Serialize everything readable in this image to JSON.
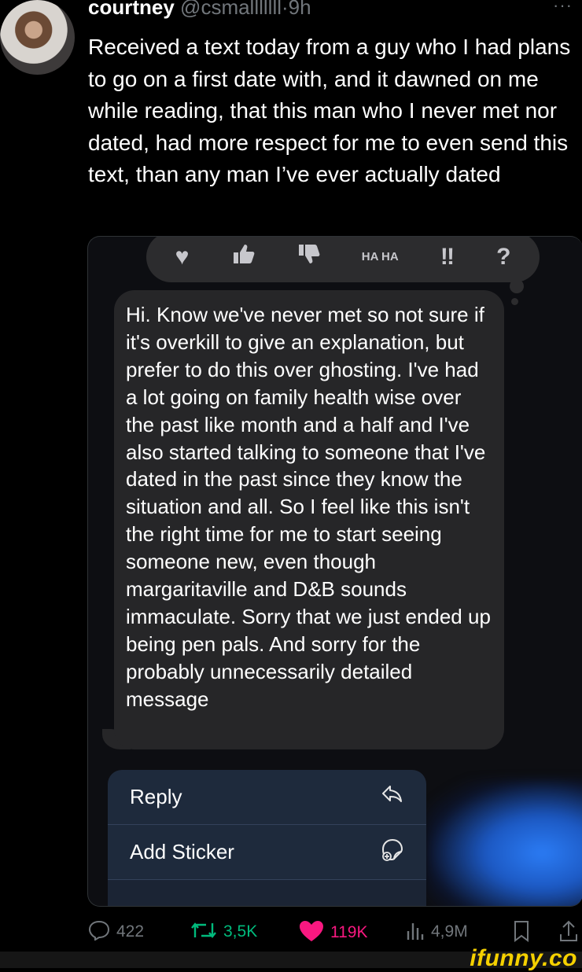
{
  "tweet": {
    "display_name": "courtney",
    "handle": "@csmalllllll",
    "separator": "·",
    "time": "9h",
    "more": "···",
    "text": "Received a text today from a guy who I had plans to go on a first date with, and it dawned on me while reading, that this man who I never met nor dated, had more respect for me to even send this text, than any man I’ve ever actually dated"
  },
  "screenshot": {
    "reactions": [
      "♥",
      "👍",
      "👎",
      "HA HA",
      "‼",
      "?"
    ],
    "message": "Hi. Know we've never met so not sure if it's overkill to give an explanation, but prefer to do this over ghosting. I've had a lot going on family health wise over the past like month and a half and I've also started talking to someone that I've dated in the past since they know the situation and all. So I feel like this isn't the right time for me to start seeing someone new, even though margaritaville and D&B sounds immaculate. Sorry that we just ended up being pen pals. And sorry for the probably unnecessarily detailed message",
    "menu": [
      {
        "label": "Reply",
        "icon": "reply-arrow-icon"
      },
      {
        "label": "Add Sticker",
        "icon": "sticker-icon"
      }
    ]
  },
  "actions": {
    "replies": "422",
    "retweets": "3,5K",
    "likes": "119K",
    "views": "4,9M"
  },
  "watermark": "ifunny.co",
  "colors": {
    "like": "#f91880",
    "retweet": "#00ba7c",
    "bubble": "#262628",
    "brand": "#f5d000"
  }
}
